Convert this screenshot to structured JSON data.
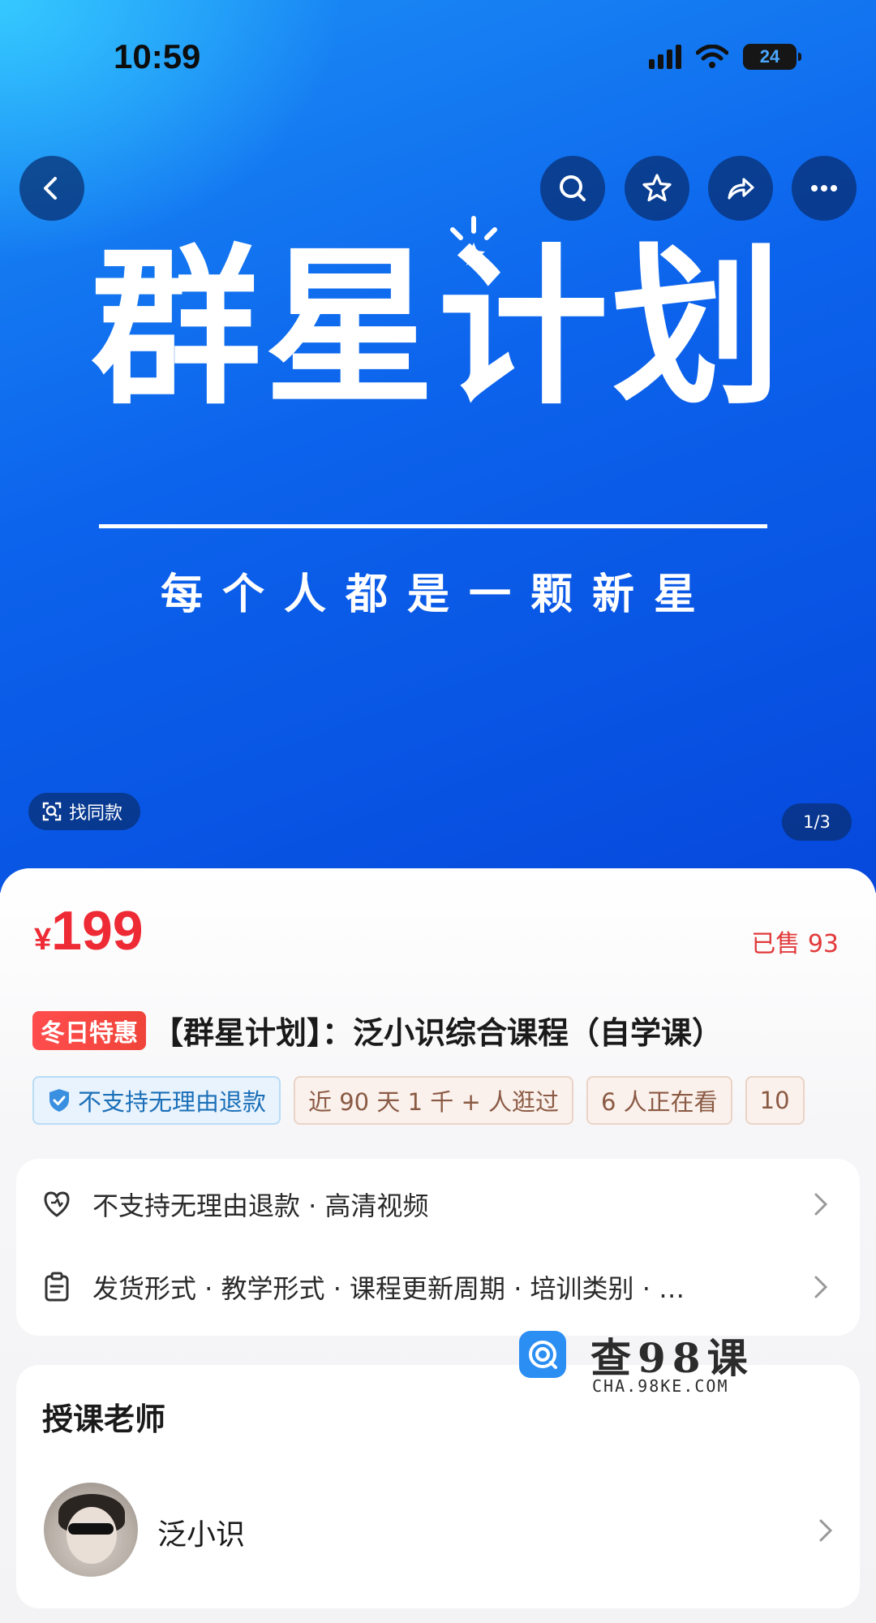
{
  "status_bar": {
    "time": "10:59",
    "battery": "24"
  },
  "hero": {
    "title": "群星计划",
    "slogan": "每个人都是一颗新星",
    "find_same": "找同款",
    "pager": "1/3"
  },
  "nav_icons": [
    "back-icon",
    "search-icon",
    "star-icon",
    "share-icon",
    "more-icon"
  ],
  "product": {
    "currency": "¥",
    "price": "199",
    "sold": "已售 93",
    "promo_badge": "冬日特惠",
    "title": "【群星计划】：泛小识综合课程（自学课）",
    "tags": [
      "不支持无理由退款",
      "近 90 天 1 千 + 人逛过",
      "6 人正在看",
      "10"
    ]
  },
  "attributes": {
    "service": "不支持无理由退款 · 高清视频",
    "params": "发货形式 · 教学形式 · 课程更新周期 · 培训类别 · …"
  },
  "watermark": {
    "title": "查98课",
    "subtitle": "CHA.98KE.COM"
  },
  "teacher_section": {
    "heading": "授课老师",
    "name": "泛小识"
  },
  "colors": {
    "accent_red": "#ee2a35",
    "hero_blue": "#0c63ec",
    "tag_blue": "#1b6fb8"
  }
}
